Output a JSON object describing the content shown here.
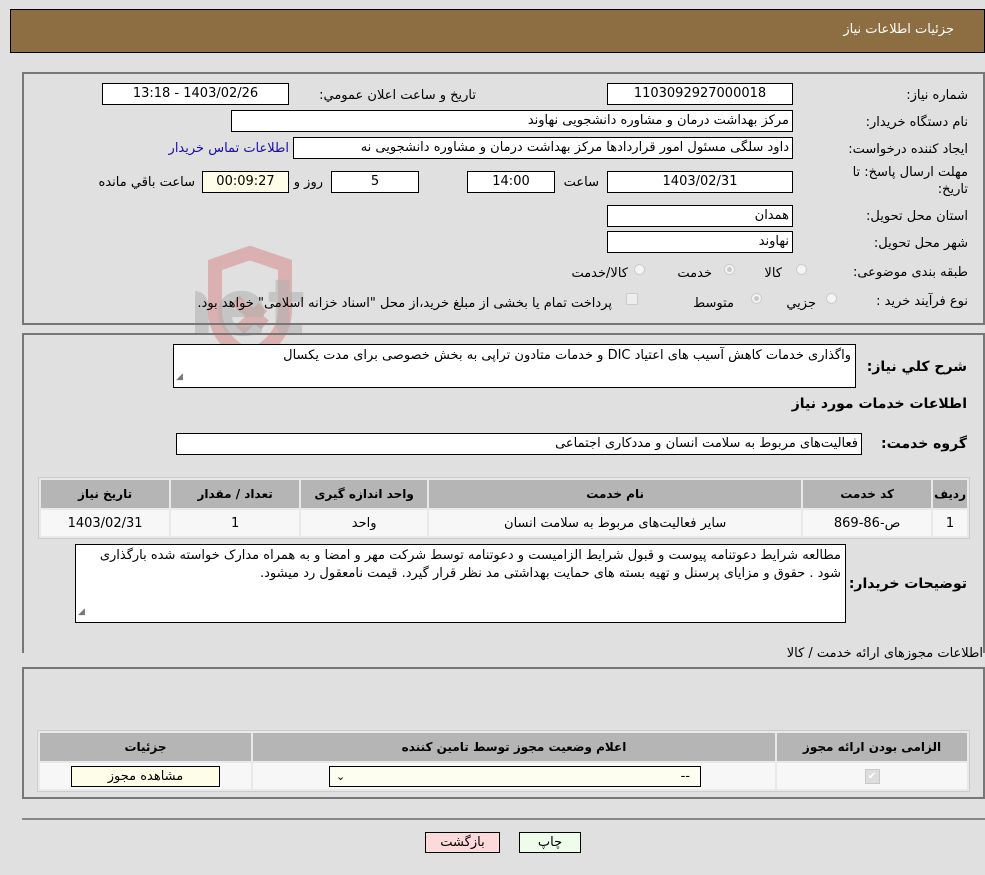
{
  "header": {
    "title": "جزئیات اطلاعات نیاز"
  },
  "form": {
    "need_number_label": "شماره نیاز:",
    "need_number": "1103092927000018",
    "announce_label": "تاريخ و ساعت اعلان عمومي:",
    "announce_value": "1403/02/26 - 13:18",
    "buyer_label": "نام دستگاه خريدار:",
    "buyer_value": "مرکز بهداشت  درمان و مشاوره دانشجویی نهاوند",
    "creator_label": "ايجاد کننده درخواست:",
    "creator_value": "داود سلگی مسئول امور قراردادها مرکز بهداشت  درمان و مشاوره دانشجویی نه",
    "contact_link": "اطلاعات تماس خريدار",
    "deadline_label_1": "مهلت ارسال پاسخ: تا",
    "deadline_label_2": "تاريخ:",
    "deadline_date": "1403/02/31",
    "time_label": "ساعت",
    "deadline_time": "14:00",
    "days_value": "5",
    "days_label": "روز و",
    "remaining_time": "00:09:27",
    "remaining_label": "ساعت باقي مانده",
    "province_label": "استان محل تحويل:",
    "province_value": "همدان",
    "city_label": "شهر محل تحويل:",
    "city_value": "نهاوند",
    "category_label": "طبقه بندی موضوعی:",
    "category_options": [
      {
        "label": "کالا",
        "selected": false
      },
      {
        "label": "خدمت",
        "selected": true
      },
      {
        "label": "کالا/خدمت",
        "selected": false
      }
    ],
    "process_label": "نوع فرآيند خريد :",
    "process_options": [
      {
        "label": "جزيي",
        "selected": false
      },
      {
        "label": "متوسط",
        "selected": true
      }
    ],
    "treasury_note": "پرداخت تمام يا بخشی از مبلغ خريد،از محل \"اسناد خزانه اسلامی\" خواهد بود.",
    "treasury_checked": false
  },
  "description": {
    "label": "شرح کلي نياز:",
    "value": "واگذاری خدمات کاهش آسیب های اعتیاد   DIC و خدمات متادون تراپی به بخش خصوصی برای مدت یکسال"
  },
  "services": {
    "section_title": "اطلاعات خدمات مورد نياز",
    "group_label": "گروه خدمت:",
    "group_value": "فعالیت‌های مربوط به سلامت انسان و مددکاری اجتماعی",
    "columns": [
      "رديف",
      "کد خدمت",
      "نام خدمت",
      "واحد اندازه گيری",
      "تعداد / مقدار",
      "تاريخ نياز"
    ],
    "rows": [
      {
        "index": "1",
        "code": "ص-86-869",
        "name": "سایر فعالیت‌های مربوط به سلامت انسان",
        "unit": "واحد",
        "qty": "1",
        "date": "1403/02/31"
      }
    ]
  },
  "buyer_notes": {
    "label": "توضيحات خريدار:",
    "value": "مطالعه شرایط دعوتنامه پیوست و قبول شرایط الزامیست و دعوتنامه توسط شرکت مهر و امضا و به همراه مدارک خواسته شده بارگذاری شود . حقوق و مزایای پرسنل و تهیه بسته های حمایت بهداشتی مد نظر قرار گیرد. قیمت نامعقول رد میشود."
  },
  "permits": {
    "section_title": "اطلاعات مجوزهای ارائه خدمت / کالا",
    "columns": [
      "الزامی بودن ارائه مجوز",
      "اعلام وضعيت مجوز توسط تامين کننده",
      "جزئيات"
    ],
    "rows": [
      {
        "required": true,
        "status_selected": "--",
        "details_button": "مشاهده مجوز"
      }
    ]
  },
  "footer": {
    "print_button": "چاپ",
    "back_button": "بازگشت"
  },
  "watermark": {
    "text": "AriaTender.net"
  },
  "colors": {
    "header_bg": "#8d6e42",
    "print_bg": "#eefdea",
    "back_bg": "#fddada",
    "yellow_field": "#fefee8",
    "link": "#1a0dab"
  }
}
